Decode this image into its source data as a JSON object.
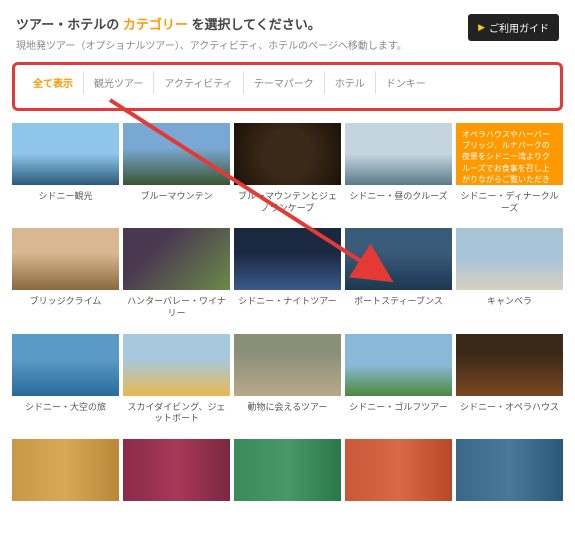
{
  "header": {
    "title_pre": "ツアー・ホテルの ",
    "title_accent": "カテゴリー ",
    "title_post": "を選択してください。",
    "subtitle": "現地発ツアー（オプショナルツアー）、アクティビティ、ホテルのページへ移動します。",
    "guide_button": "ご利用ガイド"
  },
  "tabs": [
    {
      "label": "全て表示",
      "active": true
    },
    {
      "label": "観光ツアー",
      "active": false
    },
    {
      "label": "アクティビティ",
      "active": false
    },
    {
      "label": "テーマパーク",
      "active": false
    },
    {
      "label": "ホテル",
      "active": false
    },
    {
      "label": "ドンキー",
      "active": false
    }
  ],
  "promo_text": "オペラハウスやハーバーブリッジ、ルナパークの夜景をシドニー湾よりクルーズでお食事を召し上がりながらご覧いただきます。",
  "cards": [
    {
      "label": "シドニー観光"
    },
    {
      "label": "ブルーマウンテン"
    },
    {
      "label": "ブルーマウンテンとジェノランケーブ"
    },
    {
      "label": "シドニー・昼のクルーズ"
    },
    {
      "label": "シドニー・ディナークルーズ",
      "promo": true
    },
    {
      "label": "ブリッジクライム"
    },
    {
      "label": "ハンターバレー・ワイナリー"
    },
    {
      "label": "シドニー・ナイトツアー"
    },
    {
      "label": "ポートスティーブンス"
    },
    {
      "label": "キャンベラ"
    },
    {
      "label": "シドニー・大空の旅"
    },
    {
      "label": "スカイダイビング、ジェットボート"
    },
    {
      "label": "動物に会えるツアー"
    },
    {
      "label": "シドニー・ゴルフツアー"
    },
    {
      "label": "シドニー・オペラハウス"
    },
    {
      "label": ""
    },
    {
      "label": ""
    },
    {
      "label": ""
    },
    {
      "label": ""
    },
    {
      "label": ""
    }
  ]
}
